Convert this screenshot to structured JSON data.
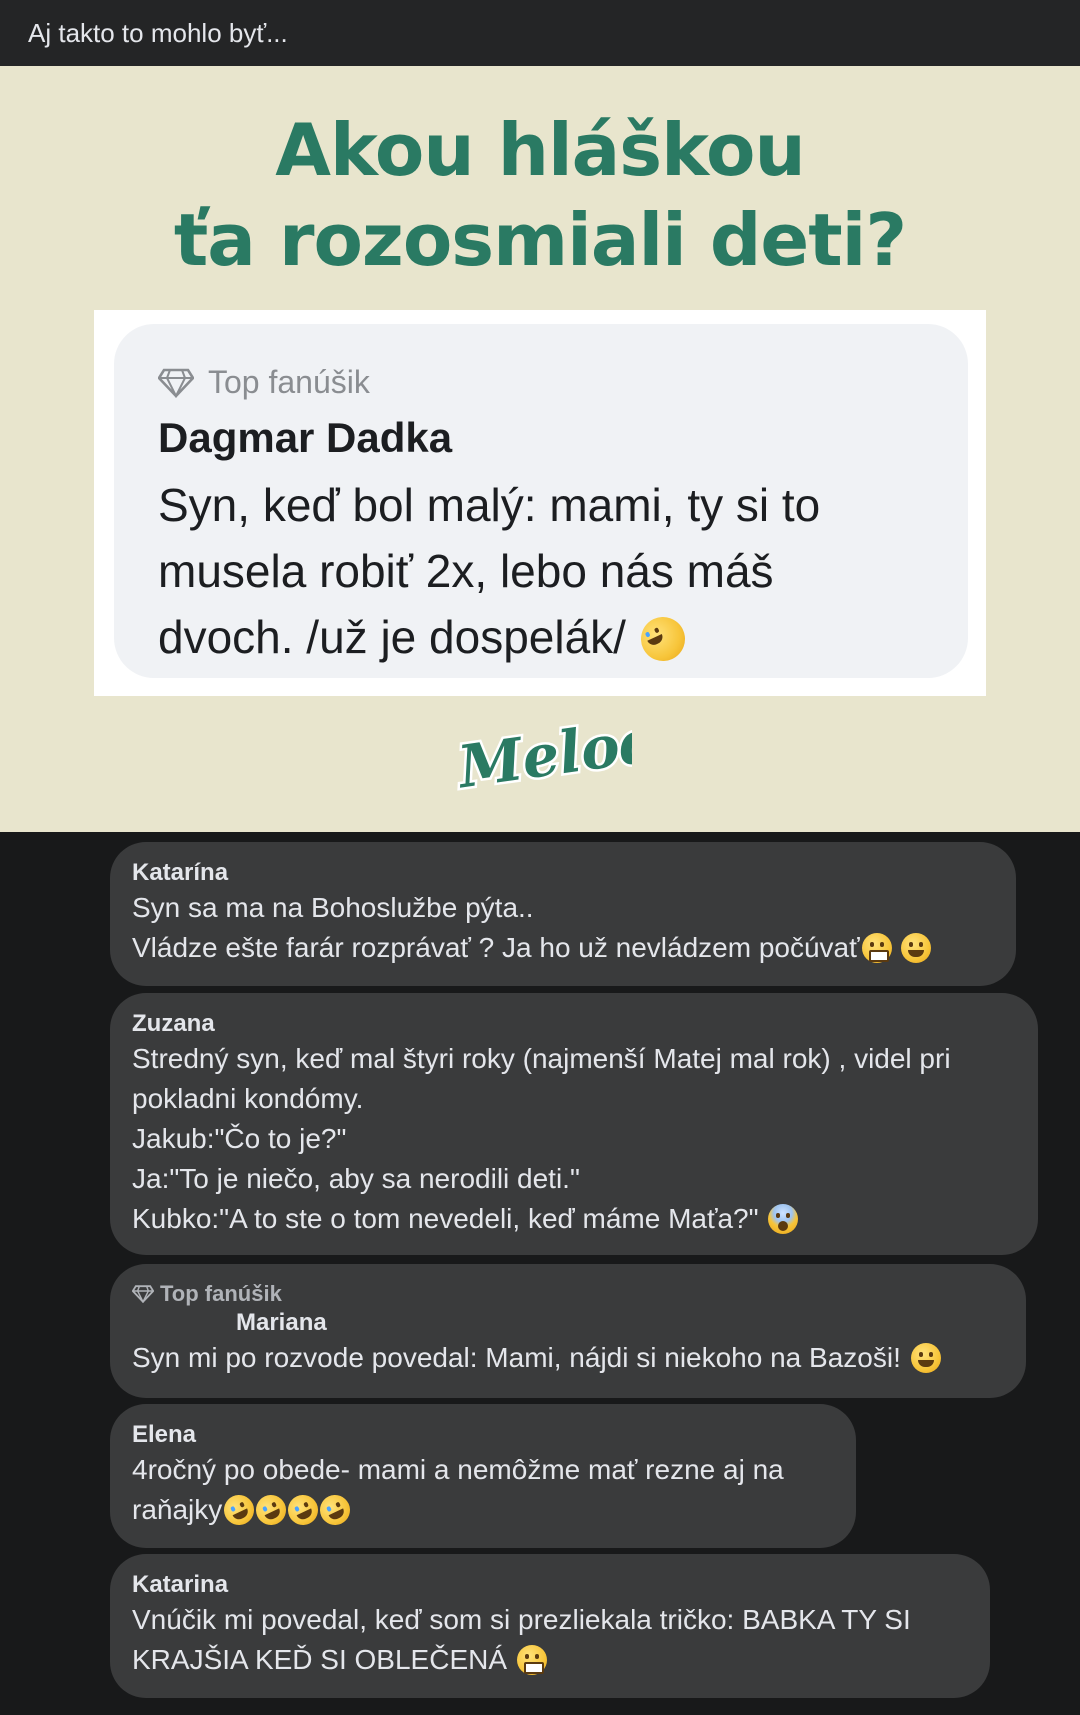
{
  "header": {
    "title": "Aj takto to mohlo byť..."
  },
  "post": {
    "headline_line1": "Akou hláškou",
    "headline_line2": "ťa rozosmiali deti?",
    "quoted_comment": {
      "badge": "Top fanúšik",
      "author": "Dagmar Dadka",
      "text": "Syn, keď bol malý: mami, ty si to musela robiť 2x, lebo nás máš dvoch. /už je dospelák/"
    },
    "logo_text": "Melody",
    "colors": {
      "background": "#e8e5cd",
      "headline": "#2a7a63"
    }
  },
  "comments": [
    {
      "author": "Katarína",
      "lines": [
        "Syn sa ma na Bohoslužbe pýta..",
        "Vládze ešte farár rozprávať ? Ja ho už nevládzem počúvať"
      ]
    },
    {
      "author": "Zuzana",
      "lines": [
        "Stredný syn, keď mal štyri roky (najmenší Matej mal rok) , videl pri",
        "pokladni kondómy.",
        "Jakub:\"Čo to je?\"",
        "Ja:\"To je niečo, aby sa nerodili deti.\"",
        "Kubko:\"A to ste o tom nevedeli, keď máme Maťa?\""
      ]
    },
    {
      "badge": "Top fanúšik",
      "author": "Mariana",
      "lines": [
        "Syn mi po rozvode povedal: Mami, nájdi si niekoho na Bazoši!"
      ]
    },
    {
      "author": "Elena",
      "lines": [
        "4ročný po obede- mami a nemôžme mať rezne aj na",
        "raňajky"
      ]
    },
    {
      "author": "Katarina",
      "lines": [
        "Vnúčik mi povedal, keď som si prezliekala tričko: BABKA TY SI",
        "KRAJŠIA KEĎ SI OBLEČENÁ"
      ]
    }
  ],
  "icons": [
    "diamond-icon",
    "grimace-emoji",
    "grin-emoji",
    "rofl-emoji",
    "scream-emoji",
    "smile-emoji",
    "laugh-emoji"
  ]
}
